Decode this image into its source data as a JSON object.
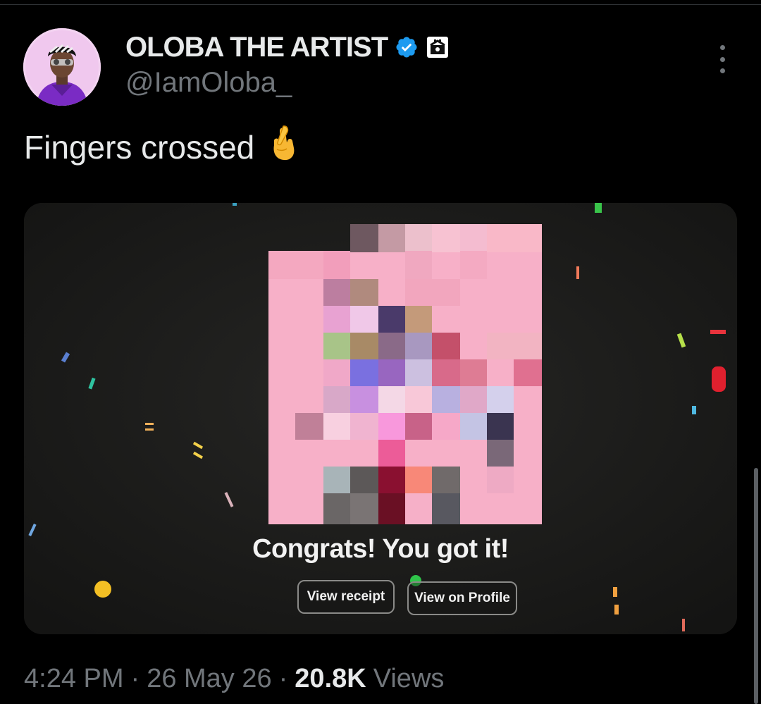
{
  "tweet": {
    "author": {
      "display_name": "OLOBA THE ARTIST",
      "handle": "@IamOloba_",
      "verified": true
    },
    "text": "Fingers crossed",
    "text_emoji": "🤞",
    "media": {
      "headline": "Congrats! You got it!",
      "buttons": [
        "View receipt",
        "View on Profile"
      ]
    },
    "meta": {
      "time": "4:24 PM",
      "date": "26 May 26",
      "views_count": "20.8K",
      "views_label": "Views",
      "separator": "·"
    }
  },
  "icons": {
    "verified": "verified-badge-icon",
    "affiliate": "affiliate-badge-icon",
    "more": "more-options-icon"
  },
  "colors": {
    "background": "#000000",
    "text_primary": "#e7e9ea",
    "text_secondary": "#71767b",
    "verified_blue": "#1d9bf0"
  }
}
